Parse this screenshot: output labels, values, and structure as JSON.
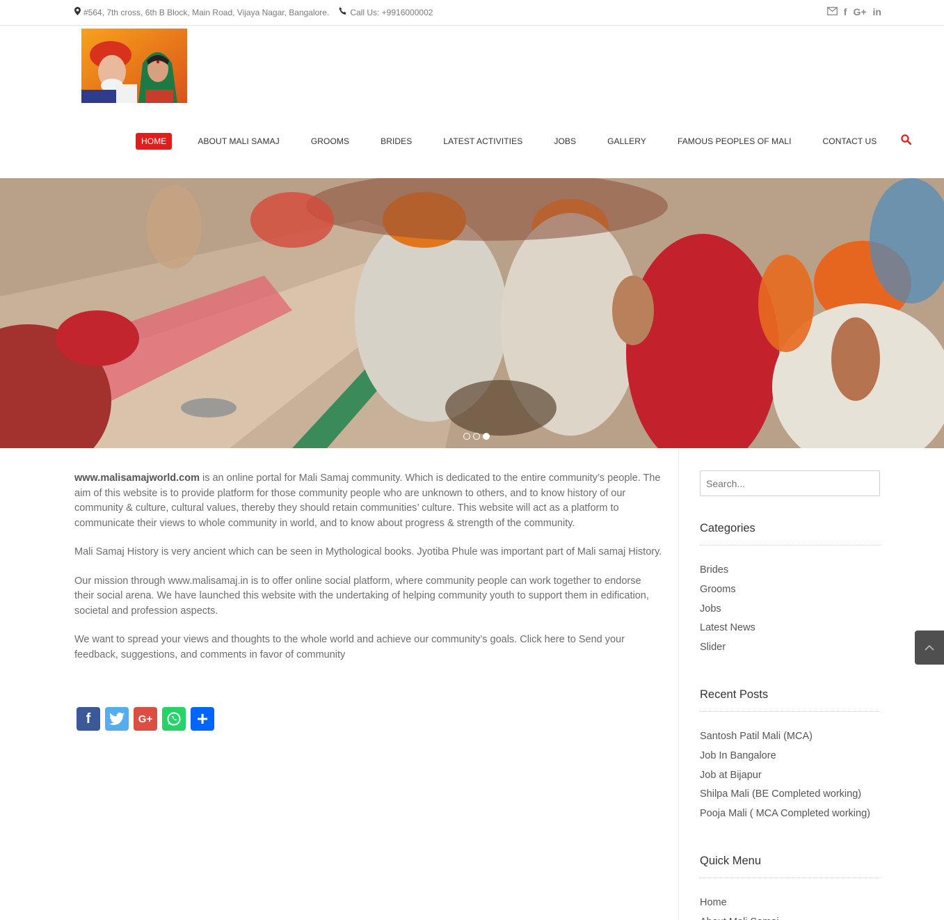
{
  "topbar": {
    "address_icon": "map-marker-icon",
    "address": "#564, 7th cross, 6th B Block, Main Road, Vijaya Nagar, Bangalore.",
    "phone_icon": "phone-icon",
    "phone": "Call Us: +9916000002",
    "social_icons": [
      "mail-icon",
      "facebook-icon",
      "google-plus-icon",
      "linkedin-icon"
    ]
  },
  "nav": {
    "items": [
      {
        "label": "HOME"
      },
      {
        "label": "ABOUT MALI SAMAJ"
      },
      {
        "label": "GROOMS"
      },
      {
        "label": "BRIDES"
      },
      {
        "label": "LATEST ACTIVITIES"
      },
      {
        "label": "JOBS"
      },
      {
        "label": "GALLERY"
      },
      {
        "label": "FAMOUS PEOPLES OF MALI"
      },
      {
        "label": "CONTACT US"
      }
    ],
    "accent_color": "#e41b1b"
  },
  "hero": {
    "slide_count": 3,
    "active_slide": 3
  },
  "content": {
    "p1_site": "www.malisamajworld.com",
    "p1_rest": " is an online portal for Mali Samaj community. Which is dedicated to the entire community’s people. The aim of this website is to provide platform for those community people who are unknown to others, and to know history of our community & culture, cultural values, thereby they should retain communities’ culture. This website will act as a platform to communicate their views to whole community in world, and to know about progress & strength of the community.",
    "p2": "Mali Samaj History is very ancient which can be seen in Mythological books. Jyotiba Phule was important part of Mali samaj History.",
    "p3": "Our mission through www.malisamaj.in is to offer online social platform, where community people can work together to endorse their social arena. We have launched this website with the undertaking of helping community youth to support them in edification, societal and profession aspects.",
    "p4": "We want to spread your views and thoughts to the whole world and achieve our community’s goals. Click here to Send your feedback, suggestions, and comments in favor of community",
    "share_buttons": [
      {
        "name": "facebook-share-icon",
        "glyph": "f",
        "color": "#3b5998"
      },
      {
        "name": "twitter-share-icon",
        "glyph": "🐦",
        "color": "#55acee"
      },
      {
        "name": "google-plus-share-icon",
        "glyph": "G+",
        "color": "#dc4e41"
      },
      {
        "name": "whatsapp-share-icon",
        "glyph": "✆",
        "color": "#25d366"
      },
      {
        "name": "share-icon",
        "glyph": "+",
        "color": "#0166ff"
      }
    ]
  },
  "sidebar": {
    "search_placeholder": "Search...",
    "categories_title": "Categories",
    "categories": [
      "Brides",
      "Grooms",
      "Jobs",
      "Latest News",
      "Slider"
    ],
    "recent_title": "Recent Posts",
    "recent_posts": [
      "Santosh Patil Mali (MCA)",
      "Job In Bangalore",
      "Job at Bijapur",
      "Shilpa Mali (BE Completed working)",
      "Pooja Mali ( MCA Completed working)"
    ],
    "quick_title": "Quick Menu",
    "quick_menu": [
      "Home",
      "About Mali Samaj"
    ]
  }
}
